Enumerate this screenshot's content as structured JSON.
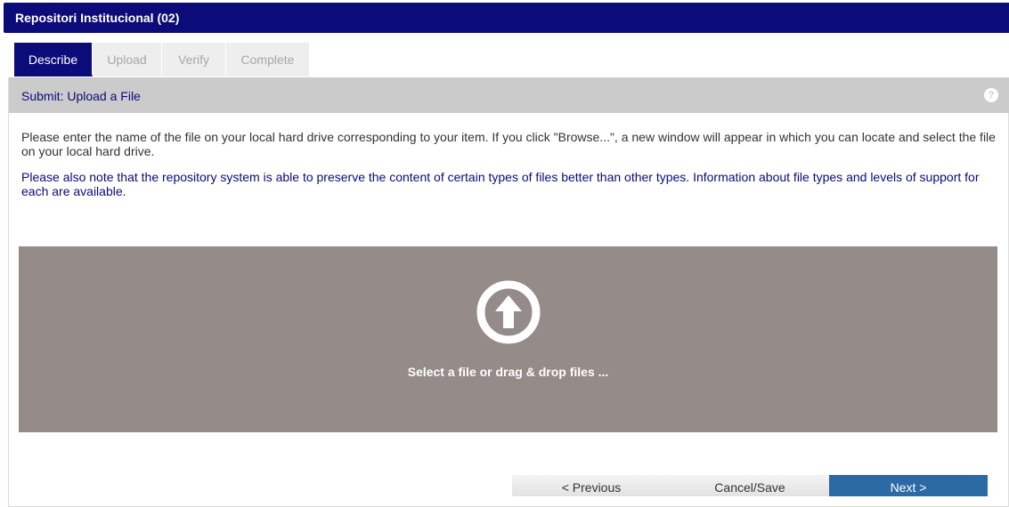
{
  "app": {
    "title": "Repositori Institucional (02)"
  },
  "tabs": [
    {
      "label": "Describe",
      "active": true
    },
    {
      "label": "Upload",
      "active": false
    },
    {
      "label": "Verify",
      "active": false
    },
    {
      "label": "Complete",
      "active": false
    }
  ],
  "panel": {
    "title": "Submit: Upload a File",
    "help_icon": "question-mark-icon",
    "instruction": "Please enter the name of the file on your local hard drive corresponding to your item. If you click \"Browse...\", a new window will appear in which you can locate and select the file on your local hard drive.",
    "note": "Please also note that the repository system is able to preserve the content of certain types of files better than other types. Information about file types and levels of support for each are available."
  },
  "dropzone": {
    "icon": "upload-arrow-icon",
    "label": "Select a file or drag & drop files ..."
  },
  "navigation": {
    "previous_label": "< Previous",
    "cancel_label": "Cancel/Save",
    "next_label": "Next >"
  },
  "colors": {
    "brand": "#0b0b79",
    "panel_header": "#cbcbcb",
    "dropzone": "#958b89",
    "next_button": "#2b6aa5"
  }
}
